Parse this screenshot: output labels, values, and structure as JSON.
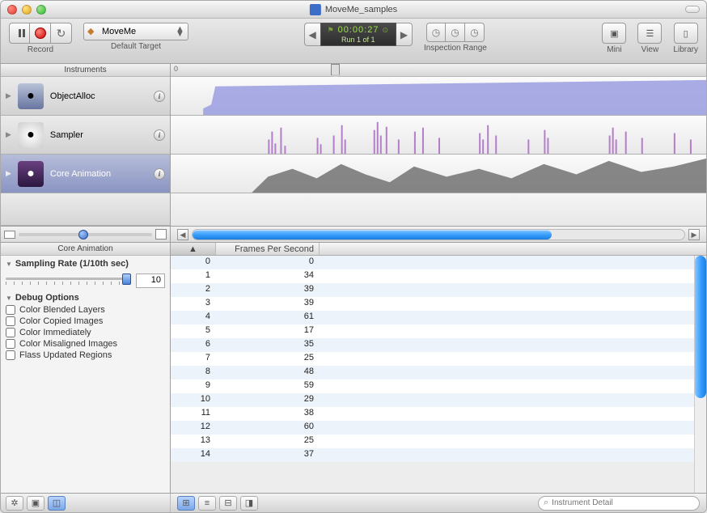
{
  "window": {
    "title": "MoveMe_samples"
  },
  "toolbar": {
    "record_label": "Record",
    "target_dropdown": "MoveMe",
    "target_sublabel": "Default Target",
    "timer": {
      "value": "00:00:27",
      "run": "Run 1 of 1"
    },
    "inspection_label": "Inspection Range",
    "mini_label": "Mini",
    "view_label": "View",
    "library_label": "Library"
  },
  "instruments_header": "Instruments",
  "tracks": [
    {
      "name": "ObjectAlloc",
      "icon_class": "alloc"
    },
    {
      "name": "Sampler",
      "icon_class": "sampler"
    },
    {
      "name": "Core Animation",
      "icon_class": "anim",
      "selected": true
    }
  ],
  "ruler": {
    "zero": "0"
  },
  "side_panel": {
    "title": "Core Animation",
    "sampling_section": "Sampling Rate (1/10th sec)",
    "sampling_value": "10",
    "debug_section": "Debug Options",
    "options": [
      "Color Blended Layers",
      "Color Copied Images",
      "Color Immediately",
      "Color Misaligned Images",
      "Flass Updated Regions"
    ]
  },
  "table": {
    "sort_indicator": "▲",
    "col_fps": "Frames Per Second",
    "rows": [
      {
        "i": 0,
        "fps": 0
      },
      {
        "i": 1,
        "fps": 34
      },
      {
        "i": 2,
        "fps": 39
      },
      {
        "i": 3,
        "fps": 39
      },
      {
        "i": 4,
        "fps": 61
      },
      {
        "i": 5,
        "fps": 17
      },
      {
        "i": 6,
        "fps": 35
      },
      {
        "i": 7,
        "fps": 25
      },
      {
        "i": 8,
        "fps": 48
      },
      {
        "i": 9,
        "fps": 59
      },
      {
        "i": 10,
        "fps": 29
      },
      {
        "i": 11,
        "fps": 38
      },
      {
        "i": 12,
        "fps": 60
      },
      {
        "i": 13,
        "fps": 25
      },
      {
        "i": 14,
        "fps": 37
      }
    ]
  },
  "search_placeholder": "Instrument Detail"
}
